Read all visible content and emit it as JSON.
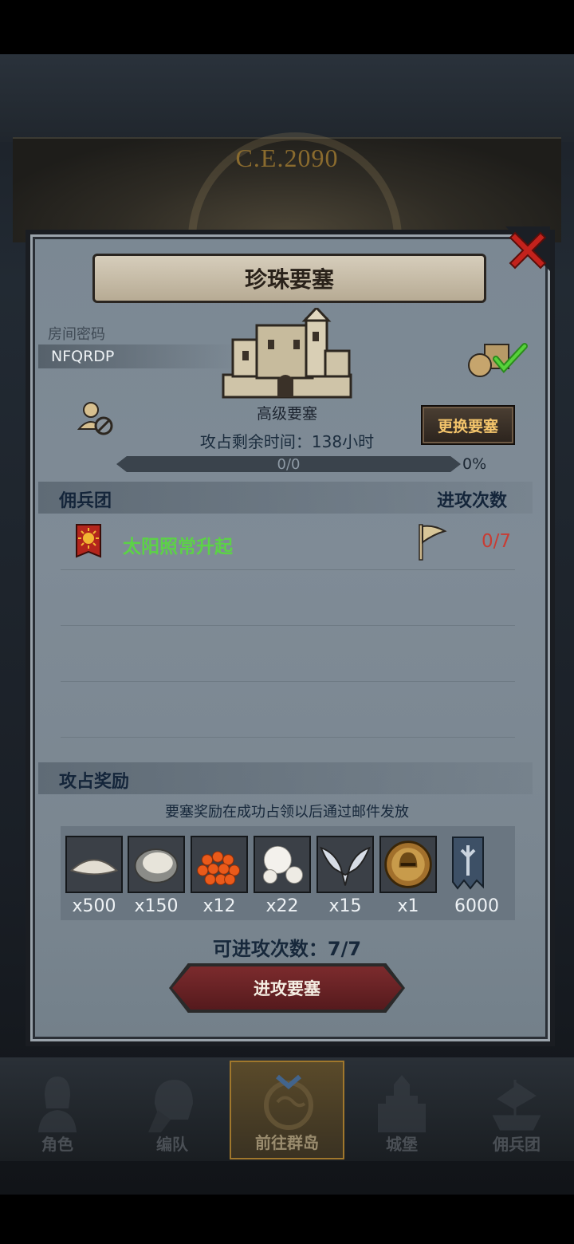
{
  "header": {
    "era_label": "C.E.2090"
  },
  "dialog": {
    "title": "珍珠要塞",
    "room": {
      "label": "房间密码",
      "code": "NFQRDP"
    },
    "fortress": {
      "level": "高级要塞",
      "time_left": "攻占剩余时间：138小时"
    },
    "change_button": "更换要塞",
    "progress": {
      "text": "0/0",
      "percent_label": "0%",
      "value": 0
    },
    "guild_section": {
      "left": "佣兵团",
      "right": "进攻次数"
    },
    "guilds": [
      {
        "name": "太阳照常升起",
        "attacks": "0/7"
      }
    ],
    "rewards_section": {
      "title": "攻占奖励",
      "note": "要塞奖励在成功占领以后通过邮件发放"
    },
    "rewards": [
      {
        "icon": "salt-pile-icon",
        "count": "x500"
      },
      {
        "icon": "oyster-icon",
        "count": "x150"
      },
      {
        "icon": "fish-roe-icon",
        "count": "x12"
      },
      {
        "icon": "pearl-icon",
        "count": "x22"
      },
      {
        "icon": "bat-wing-emblem-icon",
        "count": "x15"
      },
      {
        "icon": "knight-helmet-coin-icon",
        "count": "x1"
      },
      {
        "icon": "guild-banner-icon",
        "count": "6000"
      }
    ],
    "attack_count": "可进攻次数：7/7",
    "attack_button": "进攻要塞"
  },
  "nav": {
    "items": [
      {
        "label": "角色"
      },
      {
        "label": "编队"
      },
      {
        "label": "前往群岛",
        "active": true
      },
      {
        "label": "城堡"
      },
      {
        "label": "佣兵团"
      }
    ]
  },
  "colors": {
    "accent_gold": "#f3c46b",
    "guild_name": "#5cd247",
    "attack_red": "#c83c33"
  }
}
